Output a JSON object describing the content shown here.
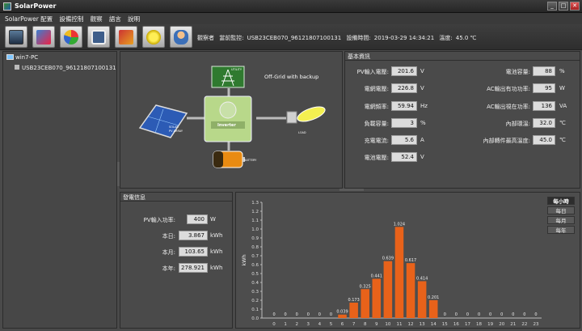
{
  "window": {
    "title": "SolarPower"
  },
  "menu": [
    "SolarPower 配置",
    "設備控制",
    "觀察",
    "語言",
    "說明"
  ],
  "toolbar": {
    "buttons": [
      {
        "name": "monitor-button",
        "icon": "monitor-icon"
      },
      {
        "name": "settings-button",
        "icon": "settings-icon"
      },
      {
        "name": "data-chart-button",
        "icon": "pie-chart-icon"
      },
      {
        "name": "camera-button",
        "icon": "camera-icon"
      },
      {
        "name": "tools-button",
        "icon": "tools-icon"
      },
      {
        "name": "light-button",
        "icon": "lightbulb-icon"
      },
      {
        "name": "user-help-button",
        "icon": "user-icon"
      }
    ],
    "observer_label": "觀察者",
    "current_monitor_label": "當前監控:",
    "current_monitor_value": "USB23CEB070_96121807100131",
    "device_time_label": "設備時間:",
    "device_time_value": "2019-03-29 14:34:21",
    "temperature_label": "溫度:",
    "temperature_value": "45.0 ℃"
  },
  "tree": {
    "root": "win7-PC",
    "device": "USB23CEB070_96121807100131"
  },
  "diagram": {
    "mode_label": "Off-Grid with backup",
    "utility_label": "UTILITY",
    "inverter_label": "Inverter",
    "pv_label_1": "SOLAR",
    "pv_label_2": "PV ARRAY",
    "load_label": "LOAD",
    "battery_label": "BATTERY"
  },
  "basic": {
    "title": "基本資訊",
    "left": [
      {
        "label": "PV輸入電壓:",
        "value": "201.6",
        "unit": "V"
      },
      {
        "label": "電網電壓:",
        "value": "226.8",
        "unit": "V"
      },
      {
        "label": "電網頻率:",
        "value": "59.94",
        "unit": "Hz"
      },
      {
        "label": "負載容量:",
        "value": "3",
        "unit": "%"
      },
      {
        "label": "充電電流:",
        "value": "5.6",
        "unit": "A"
      },
      {
        "label": "電池電壓:",
        "value": "52.4",
        "unit": "V"
      }
    ],
    "right": [
      {
        "label": "電池容量:",
        "value": "88",
        "unit": "%"
      },
      {
        "label": "AC輸出有功功率:",
        "value": "95",
        "unit": "W"
      },
      {
        "label": "AC輸出視在功率:",
        "value": "136",
        "unit": "VA"
      },
      {
        "label": "內部環溫:",
        "value": "32.0",
        "unit": "℃"
      },
      {
        "label": "內部轉件最高溫度:",
        "value": "45.0",
        "unit": "℃"
      }
    ]
  },
  "generation": {
    "title": "發電信息",
    "rows": [
      {
        "label": "PV輸入功率:",
        "value": "400",
        "unit": "W"
      },
      {
        "label": "本日:",
        "value": "3.867",
        "unit": "kWh"
      },
      {
        "label": "本月:",
        "value": "103.65",
        "unit": "kWh"
      },
      {
        "label": "本年:",
        "value": "278.921",
        "unit": "kWh"
      }
    ]
  },
  "chart_buttons": [
    {
      "label": "每小時",
      "active": true
    },
    {
      "label": "每日",
      "active": false
    },
    {
      "label": "每月",
      "active": false
    },
    {
      "label": "每年",
      "active": false
    }
  ],
  "chart_data": {
    "type": "bar",
    "ylabel": "kWh",
    "ylim": [
      0,
      1.3
    ],
    "yticks": [
      "0.0",
      "0.1",
      "0.2",
      "0.3",
      "0.4",
      "0.5",
      "0.6",
      "0.7",
      "0.8",
      "0.9",
      "1.0",
      "1.1",
      "1.2",
      "1.3"
    ],
    "categories": [
      "0",
      "1",
      "2",
      "3",
      "4",
      "5",
      "6",
      "7",
      "8",
      "9",
      "10",
      "11",
      "12",
      "13",
      "14",
      "15",
      "16",
      "17",
      "18",
      "19",
      "20",
      "21",
      "22",
      "23"
    ],
    "values": [
      0,
      0,
      0,
      0,
      0,
      0,
      0.039,
      0.173,
      0.325,
      0.441,
      0.639,
      1.024,
      0.617,
      0.414,
      0.201,
      0,
      0,
      0,
      0,
      0,
      0,
      0,
      0,
      0
    ],
    "value_labels": [
      "0",
      "0",
      "0",
      "0",
      "0",
      "0",
      "0.039",
      "0.173",
      "0.325",
      "0.441",
      "0.639",
      "1.024",
      "0.617",
      "0.414",
      "0.201",
      "0",
      "0",
      "0",
      "0",
      "0",
      "0",
      "0",
      "0",
      "0"
    ],
    "bar_color": "#e8621a",
    "grid": false
  }
}
